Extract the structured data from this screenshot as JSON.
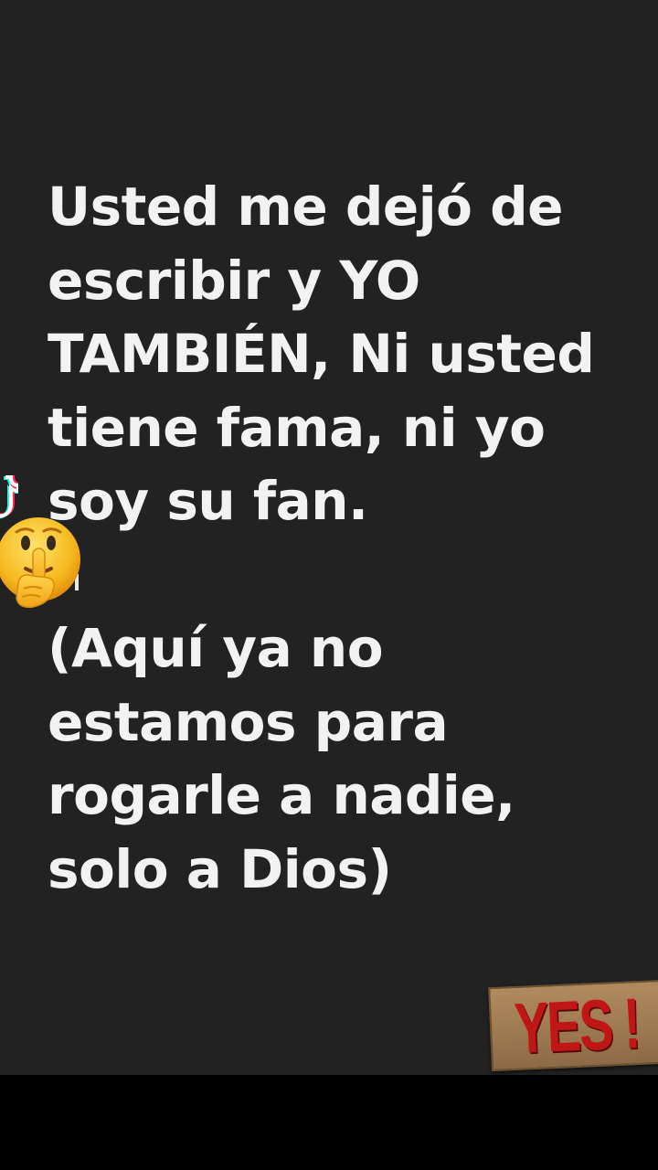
{
  "message": {
    "lines": [
      "Usted me dejó de",
      "escribir y YO",
      "TAMBIÉN, Ni usted",
      "tiene fama, ni yo",
      "soy su fan."
    ],
    "aside_lines": [
      "(Aquí ya no",
      "estamos para",
      "rogarle a nadie,",
      "solo a Dios)"
    ]
  },
  "stickers": {
    "emoji": "shushing-face-emoji",
    "yes_label": "YES !"
  },
  "colors": {
    "background": "#222222",
    "text": "#f2f2f2",
    "bottom_bar": "#000000",
    "yes_red": "#c11616",
    "yes_card": "#a58158"
  }
}
